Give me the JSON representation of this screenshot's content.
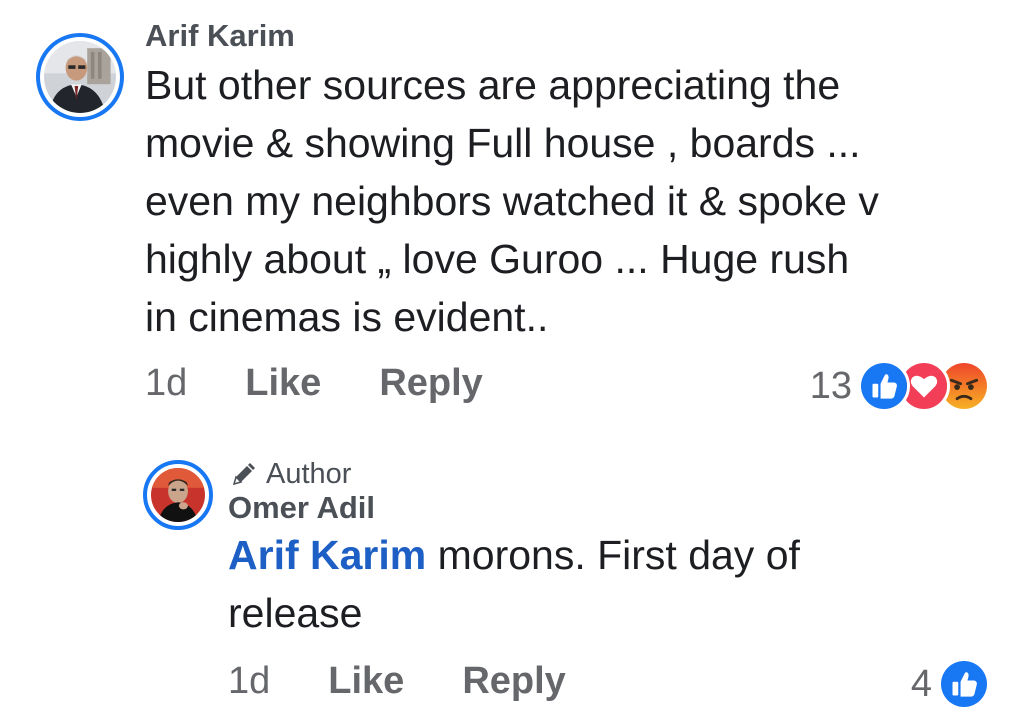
{
  "comment": {
    "author": "Arif Karim",
    "lines": [
      "But other sources are appreciating the",
      "movie & showing Full house , boards ...",
      "even my neighbors watched it & spoke v",
      "highly about „ love Guroo ... Huge rush",
      "in cinemas is evident.."
    ],
    "time": "1d",
    "like_label": "Like",
    "reply_label": "Reply",
    "reaction_count": "13",
    "reactions": [
      "like-icon",
      "love-icon",
      "angry-icon"
    ]
  },
  "reply": {
    "badge": "Author",
    "author": "Omer Adil",
    "mention": "Arif Karim",
    "text_first": " morons. First day of",
    "text_second": "release",
    "time": "1d",
    "like_label": "Like",
    "reply_label": "Reply",
    "reaction_count": "4",
    "reactions": [
      "like-icon"
    ]
  },
  "colors": {
    "accent": "#1877f2",
    "mention": "#1d5fc4",
    "meta_text": "#65676b",
    "love": "#f33e58",
    "angry": "#e9710f"
  }
}
